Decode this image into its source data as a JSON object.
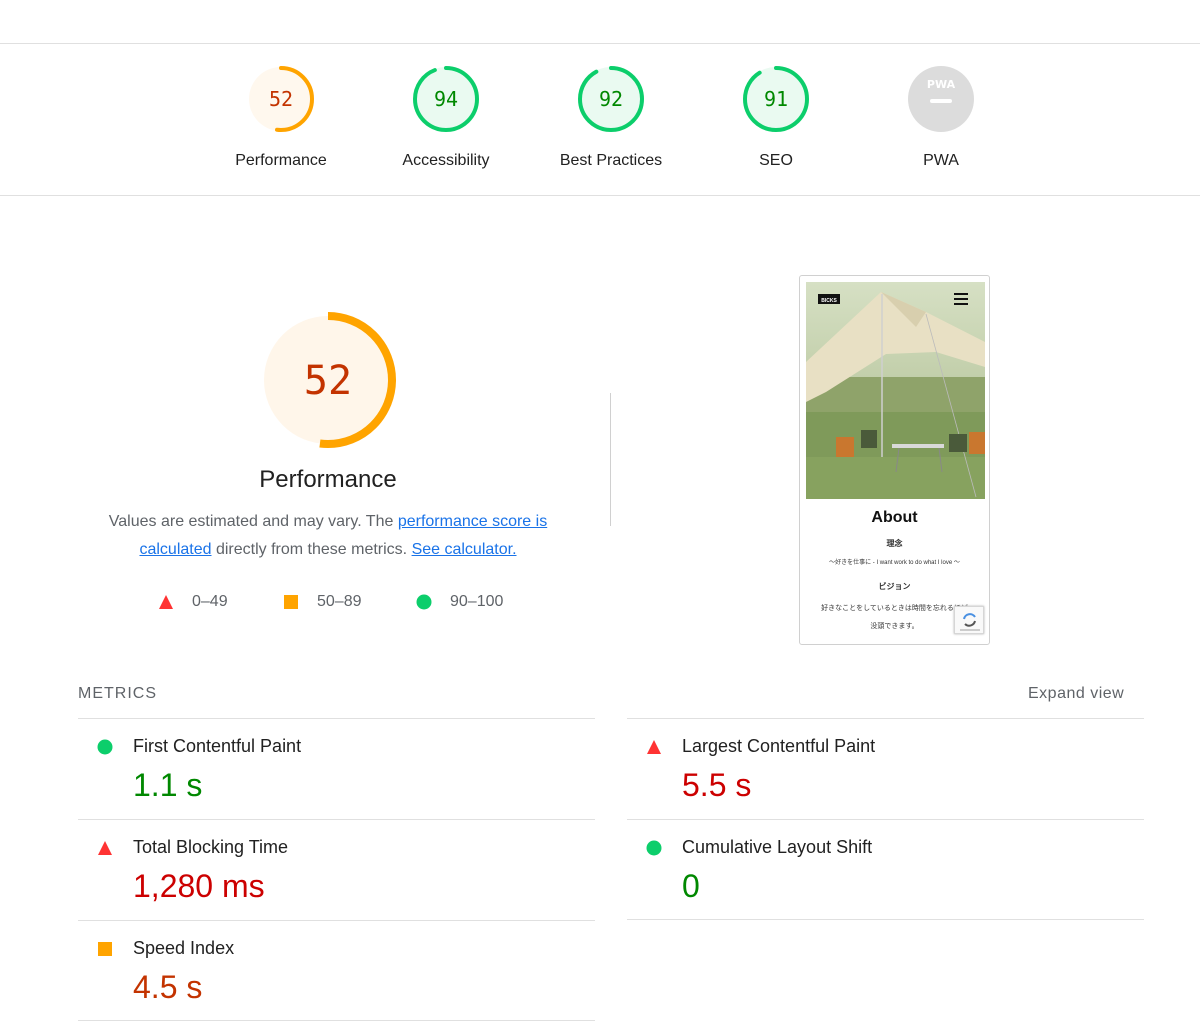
{
  "colors": {
    "fail": "#cc0000",
    "average": "#c33300",
    "pass": "#008800",
    "fail_icon": "#ff3333",
    "average_icon": "#ffa400",
    "pass_icon": "#0cce6b",
    "link": "#1a73e8"
  },
  "summary": {
    "gauges": [
      {
        "label": "Performance",
        "score": "52",
        "value": 0.52,
        "rating": "average"
      },
      {
        "label": "Accessibility",
        "score": "94",
        "value": 0.94,
        "rating": "pass"
      },
      {
        "label": "Best Practices",
        "score": "92",
        "value": 0.92,
        "rating": "pass"
      },
      {
        "label": "SEO",
        "score": "91",
        "value": 0.91,
        "rating": "pass"
      },
      {
        "label": "PWA",
        "score": "PWA",
        "rating": "na"
      }
    ]
  },
  "main": {
    "score": "52",
    "score_value": 0.52,
    "title": "Performance",
    "desc_before": "Values are estimated and may vary. The ",
    "desc_link": "performance score is calculated",
    "desc_middle": " directly from these metrics. ",
    "calc_link": "See calculator.",
    "legend": [
      {
        "range": "0–49",
        "icon": "triangle-icon"
      },
      {
        "range": "50–89",
        "icon": "square-icon"
      },
      {
        "range": "90–100",
        "icon": "circle-icon"
      }
    ]
  },
  "screenshot": {
    "logo": "BICKS",
    "heading": "About",
    "subheading1": "理念",
    "line1": "～好きを仕事に - I want work to do what I love ～",
    "subheading2": "ビジョン",
    "line2": "好きなことをしているときは時間を忘れるほど",
    "line3": "没頭できます。"
  },
  "metrics": {
    "heading": "METRICS",
    "expand_label": "Expand view",
    "items": [
      {
        "title": "First Contentful Paint",
        "value": "1.1 s",
        "rating": "pass",
        "icon": "circle-icon"
      },
      {
        "title": "Largest Contentful Paint",
        "value": "5.5 s",
        "rating": "fail",
        "icon": "triangle-icon"
      },
      {
        "title": "Total Blocking Time",
        "value": "1,280 ms",
        "rating": "fail",
        "icon": "triangle-icon"
      },
      {
        "title": "Cumulative Layout Shift",
        "value": "0",
        "rating": "pass",
        "icon": "circle-icon"
      },
      {
        "title": "Speed Index",
        "value": "4.5 s",
        "rating": "average",
        "icon": "square-icon"
      }
    ]
  }
}
